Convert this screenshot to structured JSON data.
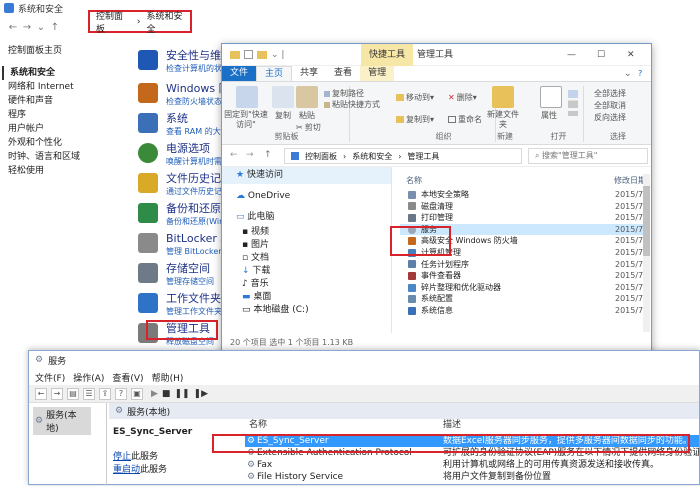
{
  "control_panel": {
    "title": "系统和安全",
    "breadcrumb": [
      "控制面板",
      "系统和安全"
    ],
    "left_nav": [
      "控制面板主页",
      "系统和安全",
      "网络和 Internet",
      "硬件和声音",
      "程序",
      "用户帐户",
      "外观和个性化",
      "时钟、语言和区域",
      "轻松使用"
    ],
    "categories": [
      {
        "title": "安全性与维护",
        "sub": "检查计算机的状态",
        "color": "#1f57b5"
      },
      {
        "title": "Windows 防",
        "sub": "检查防火墙状态",
        "color": "#c4681c"
      },
      {
        "title": "系统",
        "sub": "查看 RAM 的大小",
        "color": "#3b6fb8"
      },
      {
        "title": "电源选项",
        "sub": "唤醒计算机时需要",
        "color": "#3a8a3a"
      },
      {
        "title": "文件历史记",
        "sub": "通过文件历史记",
        "color": "#d9a928"
      },
      {
        "title": "备份和还原(W",
        "sub": "备份和还原(Windo",
        "color": "#2f8b48"
      },
      {
        "title": "BitLocker 驱",
        "sub": "管理 BitLocker 驱",
        "color": "#8a8a8a"
      },
      {
        "title": "存储空间",
        "sub": "管理存储空间",
        "color": "#6e7a88"
      },
      {
        "title": "工作文件夹",
        "sub": "管理工作文件夹",
        "color": "#2f73c8"
      },
      {
        "title": "管理工具",
        "sub": "释放磁盘空间",
        "color": "#7a7a7a"
      }
    ]
  },
  "explorer": {
    "contextual_tab": "快捷工具",
    "title": "管理工具",
    "tabs": [
      "文件",
      "主页",
      "共享",
      "查看",
      "管理"
    ],
    "ribbon": {
      "pin_label": "固定到\"快速访问\"",
      "copy": "复制",
      "paste": "粘贴",
      "copy_path": "复制路径",
      "paste_shortcut": "粘贴快捷方式",
      "cut": "剪切",
      "clipboard": "剪贴板",
      "move_to": "移动到",
      "copy_to": "复制到",
      "delete": "删除",
      "rename": "重命名",
      "organize": "组织",
      "new_folder": "新建文件夹",
      "new": "新建",
      "properties": "属性",
      "open": "打开",
      "select_all": "全部选择",
      "select_none": "全部取消",
      "invert": "反向选择",
      "select": "选择"
    },
    "path": [
      "控制面板",
      "系统和安全",
      "管理工具"
    ],
    "search_placeholder": "搜索\"管理工具\"",
    "sidebar": [
      "快速访问",
      "OneDrive",
      "此电脑",
      "视频",
      "图片",
      "文档",
      "下载",
      "音乐",
      "桌面",
      "本地磁盘 (C:)"
    ],
    "col_name": "名称",
    "col_date": "修改日期",
    "files": [
      {
        "name": "本地安全策略",
        "date": "2015/7/"
      },
      {
        "name": "磁盘清理",
        "date": "2015/7/"
      },
      {
        "name": "打印管理",
        "date": "2015/7/"
      },
      {
        "name": "服务",
        "date": "2015/7/"
      },
      {
        "name": "高级安全 Windows 防火墙",
        "date": "2015/7/"
      },
      {
        "name": "计算机管理",
        "date": "2015/7/"
      },
      {
        "name": "任务计划程序",
        "date": "2015/7/"
      },
      {
        "name": "事件查看器",
        "date": "2015/7/"
      },
      {
        "name": "碎片整理和优化驱动器",
        "date": "2015/7/"
      },
      {
        "name": "系统配置",
        "date": "2015/7/"
      },
      {
        "name": "系统信息",
        "date": "2015/7/"
      }
    ],
    "status": "20 个项目    选中 1 个项目  1.13 KB"
  },
  "services": {
    "title": "服务",
    "menu": [
      "文件(F)",
      "操作(A)",
      "查看(V)",
      "帮助(H)"
    ],
    "tree_root": "服务(本地)",
    "header": "服务(本地)",
    "selected_service": "ES_Sync_Server",
    "stop_link": "停止",
    "stop_suffix": "此服务",
    "restart_link": "重启动",
    "restart_suffix": "此服务",
    "col_name": "名称",
    "col_desc": "描述",
    "rows": [
      {
        "name": "ES_Sync_Server",
        "desc": "数据Excel服务器同步服务，提供多服务器间数据同步的功能。"
      },
      {
        "name": "Extensible Authentication Protocol",
        "desc": "可扩展的身份验证协议(EAP)服务在以下情况下提供网络身份验证: 802.1x..."
      },
      {
        "name": "Fax",
        "desc": "利用计算机或网络上的可用传真资源发送和接收传真。"
      },
      {
        "name": "File History Service",
        "desc": "将用户文件复制到备份位置"
      }
    ]
  }
}
